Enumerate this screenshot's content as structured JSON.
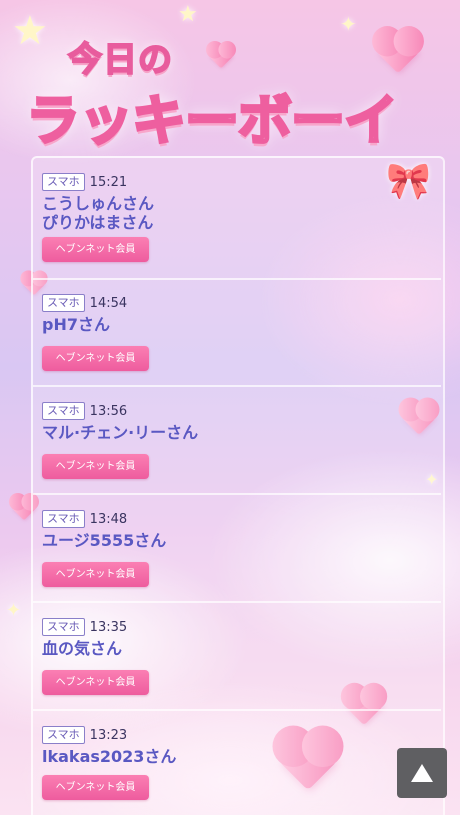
{
  "header": {
    "title_small": "今日の",
    "title_big": "ラッキーボーイ"
  },
  "entries": [
    {
      "device": "スマホ",
      "time": "15:21",
      "name": "こうしゅんさん",
      "name2": "ぴりかはまさん",
      "badge": "ヘブンネット会員"
    },
    {
      "device": "スマホ",
      "time": "14:54",
      "name": "pH7さん",
      "badge": "ヘブンネット会員"
    },
    {
      "device": "スマホ",
      "time": "13:56",
      "name": "マル·チェン·リーさん",
      "badge": "ヘブンネット会員"
    },
    {
      "device": "スマホ",
      "time": "13:48",
      "name": "ユージ5555さん",
      "badge": "ヘブンネット会員"
    },
    {
      "device": "スマホ",
      "time": "13:35",
      "name": "血の気さん",
      "badge": "ヘブンネット会員"
    },
    {
      "device": "スマホ",
      "time": "13:23",
      "name": "lkakas2023さん",
      "badge": "ヘブンネット会員"
    }
  ],
  "scroll_top": {
    "icon": "up-triangle-icon"
  },
  "colors": {
    "badge": "#ee5c9e",
    "name_text": "#5a58c2",
    "scroll_button": "#5f5f62"
  }
}
